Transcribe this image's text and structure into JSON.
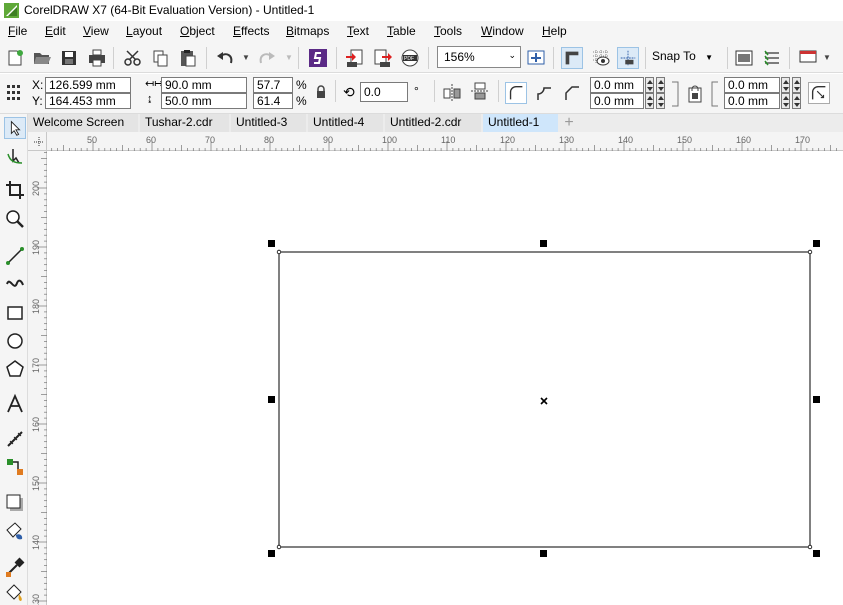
{
  "window": {
    "title": "CorelDRAW X7 (64-Bit Evaluation Version) - Untitled-1"
  },
  "menu": [
    "File",
    "Edit",
    "View",
    "Layout",
    "Object",
    "Effects",
    "Bitmaps",
    "Text",
    "Table",
    "Tools",
    "Window",
    "Help"
  ],
  "toolbar": {
    "zoom": "156%",
    "snap_to": "Snap To",
    "icons": [
      "new-icon",
      "open-icon",
      "save-icon",
      "print-icon",
      "cut-icon",
      "copy-icon",
      "paste-icon",
      "undo-icon",
      "redo-icon",
      "search-content-icon",
      "import-icon",
      "export-icon",
      "publish-pdf-icon",
      "zoom-to-page-icon",
      "full-screen-icon",
      "show-rulers-icon",
      "show-grid-icon",
      "show-guidelines-icon",
      "welcome-icon",
      "options-icon",
      "launch-icon"
    ]
  },
  "property_bar": {
    "x_label": "X:",
    "y_label": "Y:",
    "x": "126.599 mm",
    "y": "164.453 mm",
    "width": "90.0 mm",
    "height": "50.0 mm",
    "scale_x": "57.7",
    "scale_y": "61.4",
    "percent": "%",
    "rotation": "0.0",
    "degree": "°",
    "corner_top_left": "0.0 mm",
    "corner_bottom_left": "0.0 mm",
    "corner_top_right": "0.0 mm",
    "corner_bottom_right": "0.0 mm"
  },
  "tabs": [
    {
      "label": "Welcome Screen",
      "active": false
    },
    {
      "label": "Tushar-2.cdr",
      "active": false
    },
    {
      "label": "Untitled-3",
      "active": false
    },
    {
      "label": "Untitled-4",
      "active": false
    },
    {
      "label": "Untitled-2.cdr",
      "active": false
    },
    {
      "label": "Untitled-1",
      "active": true
    }
  ],
  "tab_add": "+",
  "ruler": {
    "horizontal_labels": [
      "50",
      "60",
      "70",
      "80",
      "90",
      "100",
      "110",
      "120",
      "130",
      "140",
      "150",
      "160",
      "170"
    ],
    "vertical_labels": [
      "200",
      "190",
      "180",
      "170",
      "160",
      "150",
      "140",
      "130"
    ]
  },
  "tools": [
    "pick-tool-icon",
    "shape-tool-icon",
    "crop-tool-icon",
    "zoom-tool-icon",
    "freehand-tool-icon",
    "artistic-media-tool-icon",
    "rectangle-tool-icon",
    "ellipse-tool-icon",
    "polygon-tool-icon",
    "text-tool-icon",
    "parallel-dimension-tool-icon",
    "connector-tool-icon",
    "drop-shadow-tool-icon",
    "transparency-tool-icon",
    "eyedropper-tool-icon",
    "interactive-fill-tool-icon"
  ],
  "colors": {
    "active_tab": "#cfe6fb",
    "chrome": "#f5f5f5",
    "logo_green": "#5fa838"
  }
}
